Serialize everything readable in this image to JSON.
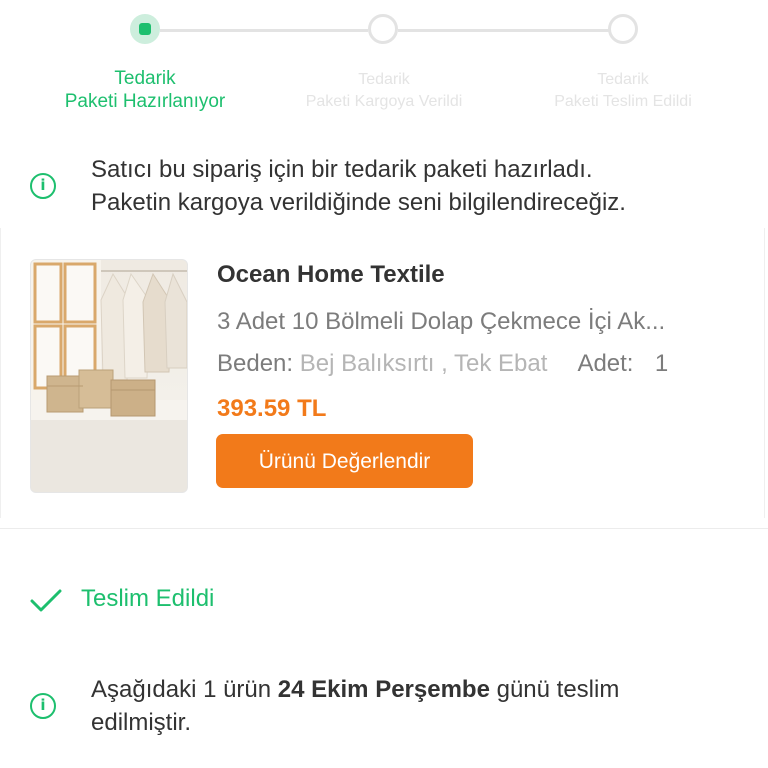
{
  "stepper": {
    "steps": [
      {
        "line1": "Tedarik",
        "line2": "Paketi Hazırlanıyor",
        "state": "active"
      },
      {
        "line1": "Tedarik",
        "line2": "Paketi Kargoya Verildi",
        "state": "inactive"
      },
      {
        "line1": "Tedarik",
        "line2": "Paketi Teslim Edildi",
        "state": "inactive"
      }
    ]
  },
  "supply_info": {
    "icon": "info-icon",
    "line1": "Satıcı bu sipariş için bir tedarik paketi hazırladı.",
    "line2": "Paketin kargoya verildiğinde seni bilgilendireceğiz."
  },
  "product": {
    "brand": "Ocean Home Textile",
    "name": "3 Adet 10 Bölmeli Dolap Çekmece İçi Ak...",
    "size_label": "Beden:",
    "size_value": "Bej Balıksırtı , Tek Ebat",
    "qty_label": "Adet:",
    "qty_value": "1",
    "price": "393.59 TL",
    "review_button": "Ürünü Değerlendir",
    "image": "product-thumbnail (storage boxes in wardrobe)"
  },
  "delivered": {
    "icon": "check-icon",
    "label": "Teslim Edildi"
  },
  "delivery_info": {
    "icon": "info-icon",
    "prefix": "Aşağıdaki 1 ürün ",
    "date": "24 Ekim Perşembe",
    "suffix": " günü teslim",
    "line2": "edilmiştir."
  },
  "colors": {
    "accent_green": "#1dbf6e",
    "accent_orange": "#f27a1a",
    "muted_text": "#7c7c7c",
    "inactive_step": "#e4e4e4"
  }
}
